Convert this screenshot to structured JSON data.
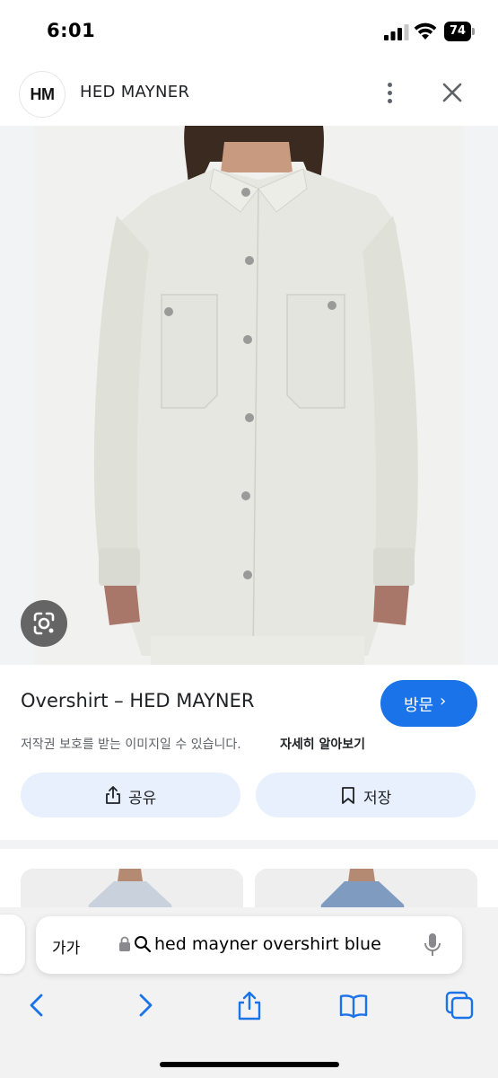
{
  "status_bar": {
    "time": "6:01",
    "battery": "74",
    "icons": [
      "cellular-signal-icon",
      "wifi-icon",
      "battery-icon"
    ]
  },
  "header": {
    "logo_text": "HM",
    "site_name": "HED MAYNER",
    "icons": [
      "more-vert-icon",
      "close-icon"
    ]
  },
  "image": {
    "lens_icon": "google-lens-icon"
  },
  "result": {
    "title": "Overshirt – HED MAYNER",
    "visit_label": "방문",
    "visit_chevron": "›",
    "copyright_notice": "저작권 보호를 받는 이미지일 수 있습니다.",
    "learn_more": "자세히 알아보기",
    "share_label": "공유",
    "save_label": "저장",
    "accent_color": "#1a73e8",
    "pill_color": "#e8f0fe"
  },
  "browser": {
    "text_size_label": "가가",
    "query": "hed mayner overshirt blue",
    "toolbar_icons": [
      "back-icon",
      "forward-icon",
      "share-icon",
      "bookmarks-icon",
      "tabs-icon"
    ]
  }
}
